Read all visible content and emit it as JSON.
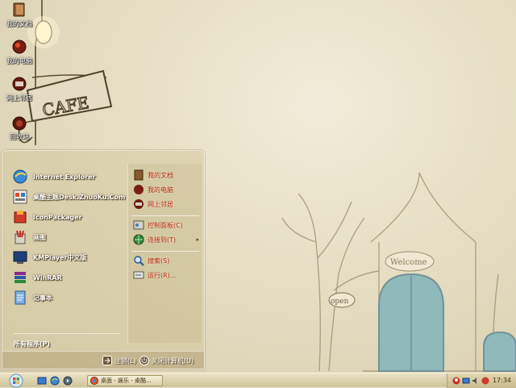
{
  "desktop": {
    "icons": [
      {
        "label": "我的文档",
        "icon": "my-documents-icon"
      },
      {
        "label": "我的电脑",
        "icon": "my-computer-icon"
      },
      {
        "label": "网上邻居",
        "icon": "network-places-icon"
      },
      {
        "label": "回收站",
        "icon": "recycle-bin-icon"
      }
    ],
    "wallpaper": {
      "sign_text": "CAFE",
      "welcome_text": "Welcome",
      "open_text": "open"
    }
  },
  "start_menu": {
    "programs": [
      {
        "label": "Internet Explorer",
        "icon": "internet-explorer-icon"
      },
      {
        "label": "桌酷主题Desk.ZhuoKu.Com",
        "icon": "zhuoku-theme-icon"
      },
      {
        "label": "IconPackager",
        "icon": "iconpackager-icon"
      },
      {
        "label": "画图",
        "icon": "paint-icon"
      },
      {
        "label": "KMPlayer中文版",
        "icon": "kmplayer-icon"
      },
      {
        "label": "WinRAR",
        "icon": "winrar-icon"
      },
      {
        "label": "记事本",
        "icon": "notepad-icon"
      }
    ],
    "all_programs": "所有程序(P)",
    "places": [
      {
        "label": "我的文档",
        "icon": "my-documents-icon"
      },
      {
        "label": "我的电脑",
        "icon": "my-computer-icon"
      },
      {
        "label": "网上邻居",
        "icon": "network-places-icon"
      }
    ],
    "system": [
      {
        "label": "控制面板(C)",
        "icon": "control-panel-icon"
      },
      {
        "label": "连接到(T)",
        "icon": "connect-to-icon"
      }
    ],
    "tools": [
      {
        "label": "搜索(S)",
        "icon": "search-icon"
      },
      {
        "label": "运行(R)...",
        "icon": "run-icon"
      }
    ],
    "logoff": "注销(L)",
    "shutdown": "关闭计算机(U)"
  },
  "taskbar": {
    "task_button": "桌面 - 娱乐 - 桌酷...",
    "clock": "17:34"
  },
  "colors": {
    "accent_text": "#b3230f",
    "taskbar": "#e3d8b2"
  }
}
